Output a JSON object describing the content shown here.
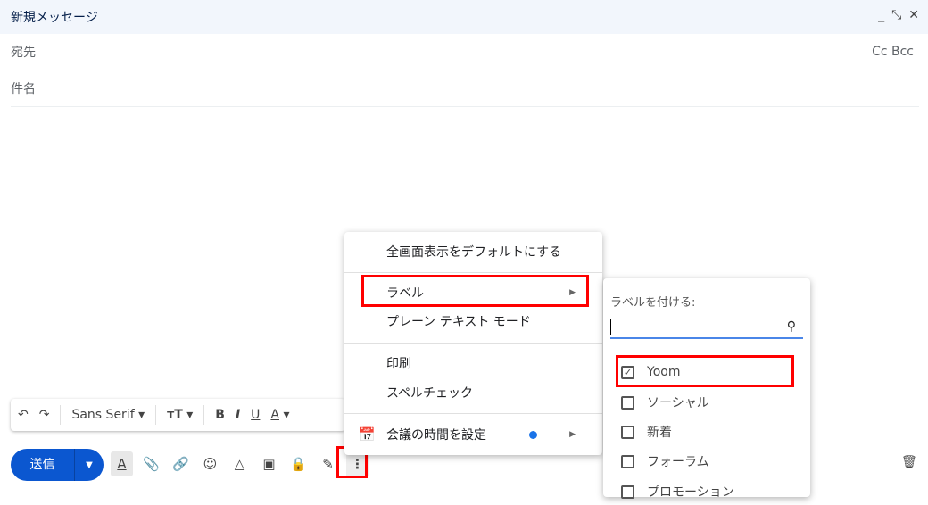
{
  "window": {
    "title": "新規メッセージ",
    "minimize": "_",
    "expand": "⤡",
    "close": "✕"
  },
  "fields": {
    "to": "宛先",
    "cc_bcc": "Cc Bcc",
    "subject": "件名"
  },
  "format_bar": {
    "undo": "↶",
    "redo": "↷",
    "font": "Sans Serif",
    "size": "тT",
    "bold": "B",
    "italic": "I",
    "underline": "U",
    "color": "A"
  },
  "send": {
    "label": "送信"
  },
  "menu": {
    "items": [
      "全画面表示をデフォルトにする",
      "ラベル",
      "プレーン テキスト モード",
      "印刷",
      "スペルチェック",
      "会議の時間を設定"
    ]
  },
  "label_menu": {
    "title": "ラベルを付ける:",
    "search_value": "",
    "labels": [
      {
        "name": "Yoom",
        "checked": true
      },
      {
        "name": "ソーシャル",
        "checked": false
      },
      {
        "name": "新着",
        "checked": false
      },
      {
        "name": "フォーラム",
        "checked": false
      },
      {
        "name": "プロモーション",
        "checked": false
      }
    ]
  },
  "colors": {
    "accent": "#0b57d0",
    "highlight": "#ff0000"
  }
}
